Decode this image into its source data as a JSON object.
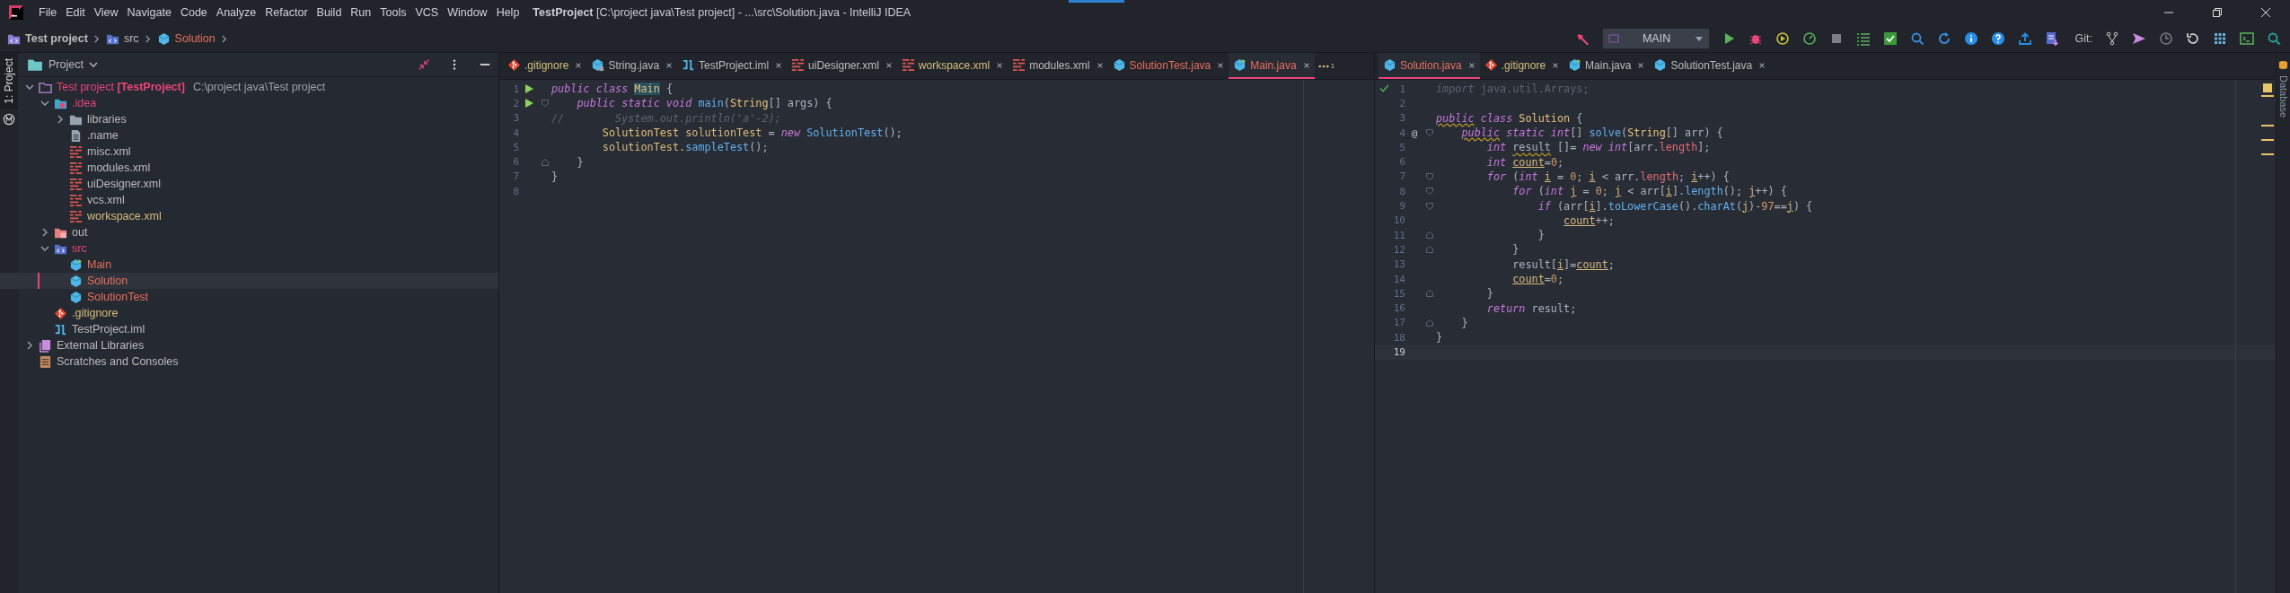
{
  "window": {
    "title": "**TestProject** [C:\\project java\\Test project] - ...\\src\\Solution.java - IntelliJ IDEA"
  },
  "menu": [
    "File",
    "Edit",
    "View",
    "Navigate",
    "Code",
    "Analyze",
    "Refactor",
    "Build",
    "Run",
    "Tools",
    "VCS",
    "Window",
    "Help"
  ],
  "breadcrumbs": [
    {
      "label": "Test project",
      "kind": "project",
      "color": "#bbbbbb"
    },
    {
      "label": "src",
      "kind": "source-folder",
      "color": "#bbbbbb"
    },
    {
      "label": "Solution",
      "kind": "class",
      "color": "#e8705f"
    }
  ],
  "toolbar": {
    "run_configuration": "MAIN",
    "git_label": "Git:"
  },
  "left_strip": {
    "tab": "1: Project"
  },
  "right_strip": {
    "tab": "Database"
  },
  "project_panel": {
    "title": "Project",
    "tree": [
      {
        "label": "Test project **[TestProject]**",
        "path": "C:\\project java\\Test project",
        "kind": "project-folder",
        "color": "#e8457a",
        "expanded": true,
        "selected": false,
        "children": [
          {
            "label": ".idea",
            "kind": "config-folder",
            "color": "#e8457a",
            "expanded": true,
            "selected": false,
            "children": [
              {
                "label": "libraries",
                "kind": "folder",
                "color": "#bbbbbb",
                "expanded": false,
                "selected": false
              },
              {
                "label": ".name",
                "kind": "text",
                "color": "#bbbbbb",
                "selected": false
              },
              {
                "label": "misc.xml",
                "kind": "xml",
                "color": "#bbbbbb",
                "selected": false
              },
              {
                "label": "modules.xml",
                "kind": "xml",
                "color": "#bbbbbb",
                "selected": false
              },
              {
                "label": "uiDesigner.xml",
                "kind": "xml",
                "color": "#bbbbbb",
                "selected": false
              },
              {
                "label": "vcs.xml",
                "kind": "xml",
                "color": "#bbbbbb",
                "selected": false
              },
              {
                "label": "workspace.xml",
                "kind": "xml",
                "color": "#d6bf7e",
                "selected": false
              }
            ]
          },
          {
            "label": "out",
            "kind": "excluded-folder",
            "color": "#bbbbbb",
            "expanded": false,
            "selected": false
          },
          {
            "label": "src",
            "kind": "source-folder",
            "color": "#e8457a",
            "expanded": true,
            "selected": false,
            "children": [
              {
                "label": "Main",
                "kind": "main-class",
                "color": "#e8705f",
                "selected": false
              },
              {
                "label": "Solution",
                "kind": "class",
                "color": "#e8705f",
                "selected": true
              },
              {
                "label": "SolutionTest",
                "kind": "class",
                "color": "#e8705f",
                "selected": false
              }
            ]
          },
          {
            "label": ".gitignore",
            "kind": "git",
            "color": "#d6bf7e",
            "selected": false
          },
          {
            "label": "TestProject.iml",
            "kind": "module",
            "color": "#bbbbbb",
            "selected": false
          }
        ]
      },
      {
        "label": "External Libraries",
        "kind": "library",
        "color": "#bbbbbb",
        "expanded": false,
        "selected": false
      },
      {
        "label": "Scratches and Consoles",
        "kind": "scratches",
        "color": "#bbbbbb",
        "selected": false
      }
    ]
  },
  "editors": [
    {
      "tabs": [
        {
          "label": ".gitignore",
          "kind": "git",
          "color": "#d6bf7e",
          "selected": false
        },
        {
          "label": "String.java",
          "kind": "locked-class",
          "color": "#bbbbbb",
          "selected": false
        },
        {
          "label": "TestProject.iml",
          "kind": "module",
          "color": "#bbbbbb",
          "selected": false
        },
        {
          "label": "uiDesigner.xml",
          "kind": "xml",
          "color": "#bbbbbb",
          "selected": false
        },
        {
          "label": "workspace.xml",
          "kind": "xml",
          "color": "#d6bf7e",
          "selected": false
        },
        {
          "label": "modules.xml",
          "kind": "xml",
          "color": "#bbbbbb",
          "selected": false
        },
        {
          "label": "SolutionTest.java",
          "kind": "class",
          "color": "#e8705f",
          "selected": false
        },
        {
          "label": "Main.java",
          "kind": "main-class",
          "color": "#e8705f",
          "selected": true
        }
      ],
      "hidden_tabs": "1",
      "lines": [
        {
          "number": "1",
          "run_marker": true,
          "fold_open": false,
          "fold_close": false,
          "current": false,
          "tokens": [
            {
              "kind": "keyword",
              "text": "public class "
            },
            {
              "kind": "type-highlight",
              "text": "Main"
            },
            {
              "kind": "plain",
              "text": " {"
            }
          ]
        },
        {
          "number": "2",
          "run_marker": true,
          "fold_open": true,
          "fold_close": false,
          "current": false,
          "tokens": [
            {
              "kind": "keyword",
              "text": "    public static void "
            },
            {
              "kind": "method",
              "text": "main"
            },
            {
              "kind": "plain",
              "text": "("
            },
            {
              "kind": "type",
              "text": "String"
            },
            {
              "kind": "plain",
              "text": "[] args) {"
            }
          ]
        },
        {
          "number": "3",
          "run_marker": false,
          "fold_open": false,
          "fold_close": false,
          "current": false,
          "tokens": [
            {
              "kind": "comment",
              "text": "//        System.out.println('a'-2);"
            }
          ]
        },
        {
          "number": "4",
          "run_marker": false,
          "fold_open": false,
          "fold_close": false,
          "current": false,
          "tokens": [
            {
              "kind": "type",
              "text": "        SolutionTest "
            },
            {
              "kind": "local",
              "text": "solutionTest"
            },
            {
              "kind": "plain",
              "text": " = "
            },
            {
              "kind": "keyword",
              "text": "new "
            },
            {
              "kind": "method",
              "text": "SolutionTest"
            },
            {
              "kind": "plain",
              "text": "();"
            }
          ]
        },
        {
          "number": "5",
          "run_marker": false,
          "fold_open": false,
          "fold_close": false,
          "current": false,
          "tokens": [
            {
              "kind": "local",
              "text": "        solutionTest."
            },
            {
              "kind": "method",
              "text": "sampleTest"
            },
            {
              "kind": "plain",
              "text": "();"
            }
          ]
        },
        {
          "number": "6",
          "run_marker": false,
          "fold_open": false,
          "fold_close": true,
          "current": false,
          "tokens": [
            {
              "kind": "plain",
              "text": "    }"
            }
          ]
        },
        {
          "number": "7",
          "run_marker": false,
          "fold_open": false,
          "fold_close": false,
          "current": false,
          "tokens": [
            {
              "kind": "plain",
              "text": "}"
            }
          ]
        },
        {
          "number": "8",
          "run_marker": false,
          "fold_open": false,
          "fold_close": false,
          "current": false
        }
      ]
    },
    {
      "tabs": [
        {
          "label": "Solution.java",
          "kind": "class",
          "color": "#e8705f",
          "selected": true
        },
        {
          "label": ".gitignore",
          "kind": "git",
          "color": "#d6bf7e",
          "selected": false
        },
        {
          "label": "Main.java",
          "kind": "main-class",
          "color": "#bbbbbb",
          "selected": false
        },
        {
          "label": "SolutionTest.java",
          "kind": "class",
          "color": "#bbbbbb",
          "selected": false
        }
      ],
      "lines": [
        {
          "number": "1",
          "fold_open": false,
          "fold_close": false,
          "current": false,
          "tokens": [
            {
              "kind": "unused-keyword",
              "text": "import"
            },
            {
              "kind": "unused",
              "text": " java.util.Arrays;"
            }
          ]
        },
        {
          "number": "2",
          "fold_open": false,
          "fold_close": false,
          "current": false
        },
        {
          "number": "3",
          "fold_open": false,
          "fold_close": false,
          "current": false,
          "tokens": [
            {
              "kind": "keyword-warning",
              "text": "public"
            },
            {
              "kind": "keyword",
              "text": " class "
            },
            {
              "kind": "type",
              "text": "Solution"
            },
            {
              "kind": "plain",
              "text": " {"
            }
          ]
        },
        {
          "number": "4",
          "mark": "@",
          "fold_open": true,
          "fold_close": false,
          "current": false,
          "tokens": [
            {
              "kind": "keyword-warning",
              "text": "    public"
            },
            {
              "kind": "keyword",
              "text": " static int"
            },
            {
              "kind": "plain",
              "text": "[] "
            },
            {
              "kind": "method",
              "text": "solve"
            },
            {
              "kind": "plain",
              "text": "("
            },
            {
              "kind": "type",
              "text": "String"
            },
            {
              "kind": "plain",
              "text": "[] arr) {"
            }
          ]
        },
        {
          "number": "5",
          "fold_open": false,
          "fold_close": false,
          "current": false,
          "tokens": [
            {
              "kind": "keyword",
              "text": "        int "
            },
            {
              "kind": "plain-warning",
              "text": "result"
            },
            {
              "kind": "plain",
              "text": " []= "
            },
            {
              "kind": "keyword",
              "text": "new int"
            },
            {
              "kind": "plain",
              "text": "[arr."
            },
            {
              "kind": "field",
              "text": "length"
            },
            {
              "kind": "plain",
              "text": "];"
            }
          ]
        },
        {
          "number": "6",
          "fold_open": false,
          "fold_close": false,
          "current": false,
          "tokens": [
            {
              "kind": "keyword",
              "text": "        int "
            },
            {
              "kind": "reassigned",
              "text": "count"
            },
            {
              "kind": "plain",
              "text": "="
            },
            {
              "kind": "number",
              "text": "0"
            },
            {
              "kind": "plain",
              "text": ";"
            }
          ]
        },
        {
          "number": "7",
          "fold_open": true,
          "fold_close": false,
          "current": false,
          "tokens": [
            {
              "kind": "keyword",
              "text": "        for"
            },
            {
              "kind": "plain",
              "text": " ("
            },
            {
              "kind": "keyword",
              "text": "int "
            },
            {
              "kind": "reassigned",
              "text": "i"
            },
            {
              "kind": "plain",
              "text": " = "
            },
            {
              "kind": "number",
              "text": "0"
            },
            {
              "kind": "plain",
              "text": "; "
            },
            {
              "kind": "reassigned",
              "text": "i"
            },
            {
              "kind": "plain",
              "text": " < arr."
            },
            {
              "kind": "field",
              "text": "length"
            },
            {
              "kind": "plain",
              "text": "; "
            },
            {
              "kind": "reassigned",
              "text": "i"
            },
            {
              "kind": "plain",
              "text": "++) {"
            }
          ]
        },
        {
          "number": "8",
          "fold_open": true,
          "fold_close": false,
          "current": false,
          "tokens": [
            {
              "kind": "keyword",
              "text": "            for"
            },
            {
              "kind": "plain",
              "text": " ("
            },
            {
              "kind": "keyword",
              "text": "int "
            },
            {
              "kind": "reassigned",
              "text": "j"
            },
            {
              "kind": "plain",
              "text": " = "
            },
            {
              "kind": "number",
              "text": "0"
            },
            {
              "kind": "plain",
              "text": "; "
            },
            {
              "kind": "reassigned",
              "text": "j"
            },
            {
              "kind": "plain",
              "text": " < arr["
            },
            {
              "kind": "reassigned",
              "text": "i"
            },
            {
              "kind": "plain",
              "text": "]."
            },
            {
              "kind": "method",
              "text": "length"
            },
            {
              "kind": "plain",
              "text": "(); "
            },
            {
              "kind": "reassigned",
              "text": "j"
            },
            {
              "kind": "plain",
              "text": "++) {"
            }
          ]
        },
        {
          "number": "9",
          "fold_open": true,
          "fold_close": false,
          "current": false,
          "tokens": [
            {
              "kind": "keyword",
              "text": "                if"
            },
            {
              "kind": "plain",
              "text": " (arr["
            },
            {
              "kind": "reassigned",
              "text": "i"
            },
            {
              "kind": "plain",
              "text": "]."
            },
            {
              "kind": "method",
              "text": "toLowerCase"
            },
            {
              "kind": "plain",
              "text": "()."
            },
            {
              "kind": "method",
              "text": "charAt"
            },
            {
              "kind": "plain",
              "text": "("
            },
            {
              "kind": "reassigned",
              "text": "j"
            },
            {
              "kind": "plain",
              "text": ")-"
            },
            {
              "kind": "number",
              "text": "97"
            },
            {
              "kind": "plain",
              "text": "=="
            },
            {
              "kind": "reassigned",
              "text": "j"
            },
            {
              "kind": "plain",
              "text": ") {"
            }
          ]
        },
        {
          "number": "10",
          "fold_open": false,
          "fold_close": false,
          "current": false,
          "tokens": [
            {
              "kind": "reassigned",
              "text": "                    count"
            },
            {
              "kind": "plain",
              "text": "++;"
            }
          ]
        },
        {
          "number": "11",
          "fold_open": false,
          "fold_close": true,
          "current": false,
          "tokens": [
            {
              "kind": "plain",
              "text": "                }"
            }
          ]
        },
        {
          "number": "12",
          "fold_open": false,
          "fold_close": true,
          "current": false,
          "tokens": [
            {
              "kind": "plain",
              "text": "            }"
            }
          ]
        },
        {
          "number": "13",
          "fold_open": false,
          "fold_close": false,
          "current": false,
          "tokens": [
            {
              "kind": "plain",
              "text": "            result["
            },
            {
              "kind": "reassigned",
              "text": "i"
            },
            {
              "kind": "plain",
              "text": "]="
            },
            {
              "kind": "reassigned",
              "text": "count"
            },
            {
              "kind": "plain",
              "text": ";"
            }
          ]
        },
        {
          "number": "14",
          "fold_open": false,
          "fold_close": false,
          "current": false,
          "tokens": [
            {
              "kind": "reassigned",
              "text": "            count"
            },
            {
              "kind": "plain",
              "text": "="
            },
            {
              "kind": "number",
              "text": "0"
            },
            {
              "kind": "plain",
              "text": ";"
            }
          ]
        },
        {
          "number": "15",
          "fold_open": false,
          "fold_close": true,
          "current": false,
          "tokens": [
            {
              "kind": "plain",
              "text": "        }"
            }
          ]
        },
        {
          "number": "16",
          "fold_open": false,
          "fold_close": false,
          "current": false,
          "tokens": [
            {
              "kind": "keyword",
              "text": "        return"
            },
            {
              "kind": "plain",
              "text": " result;"
            }
          ]
        },
        {
          "number": "17",
          "fold_open": false,
          "fold_close": true,
          "current": false,
          "tokens": [
            {
              "kind": "plain",
              "text": "    }"
            }
          ]
        },
        {
          "number": "18",
          "fold_open": false,
          "fold_close": false,
          "current": false,
          "tokens": [
            {
              "kind": "plain",
              "text": "}"
            }
          ]
        },
        {
          "number": "19",
          "fold_open": false,
          "fold_close": false,
          "current": true
        }
      ]
    }
  ]
}
